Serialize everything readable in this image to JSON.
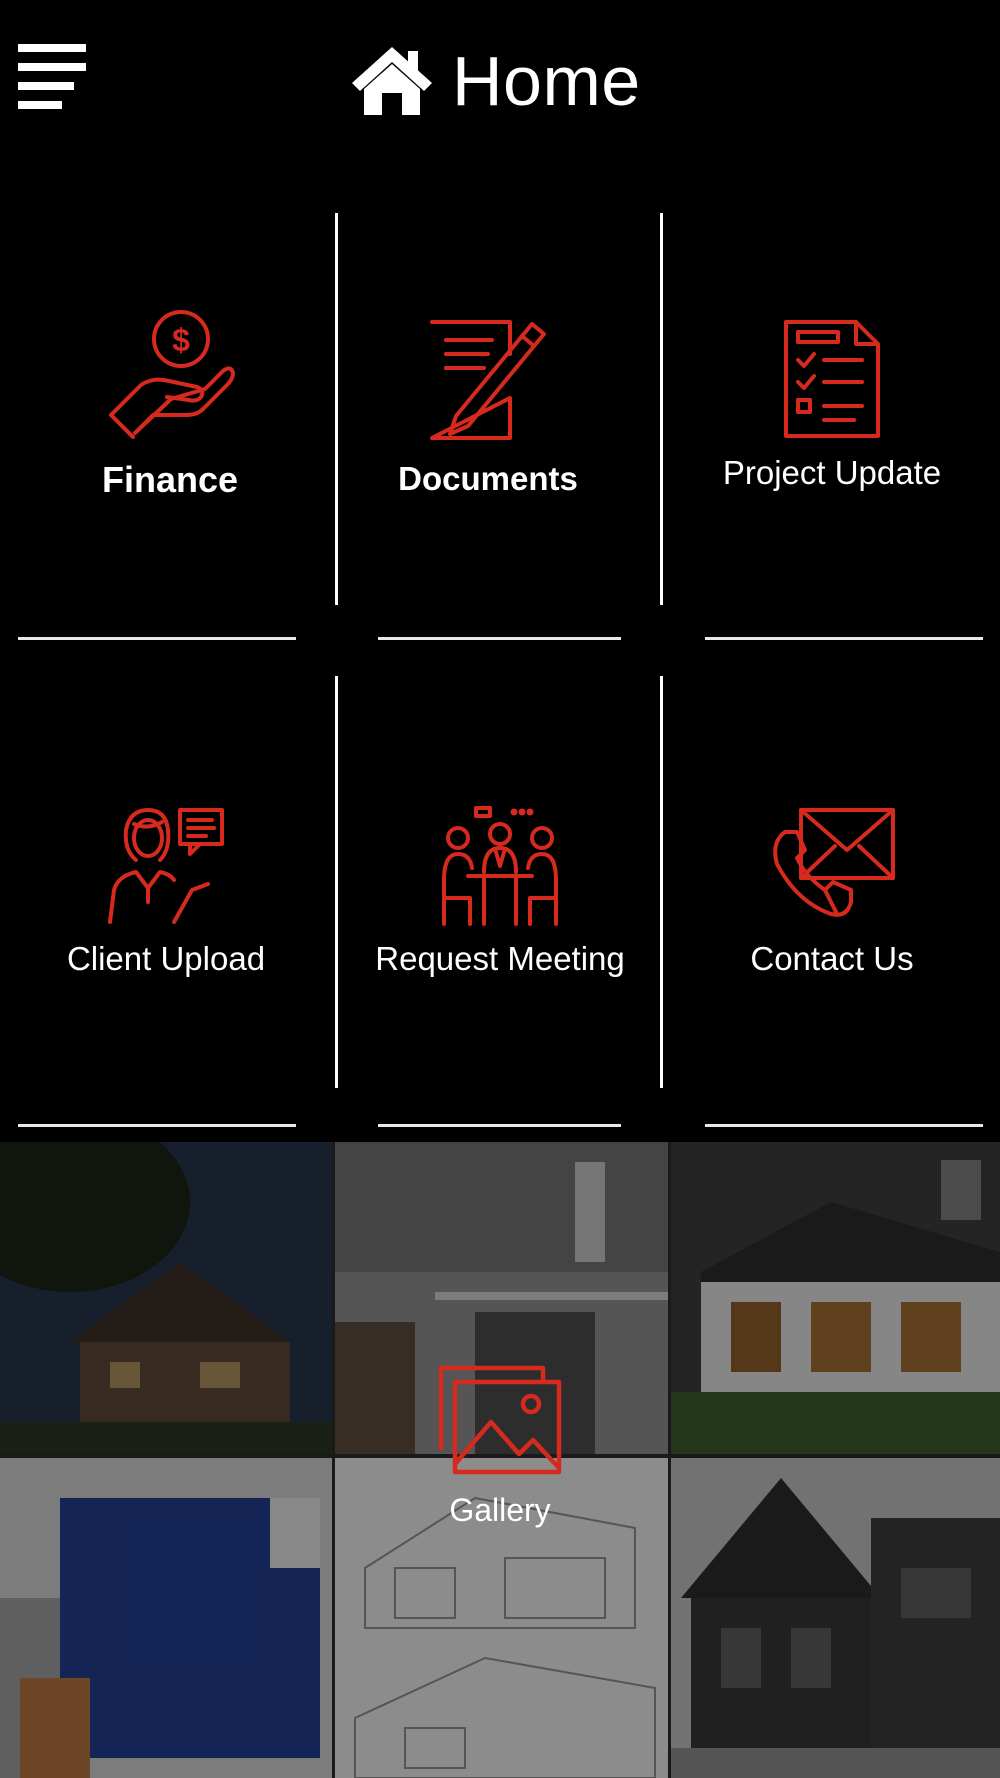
{
  "header": {
    "title": "Home",
    "menu_icon": "hamburger-menu-icon",
    "home_icon": "home-icon"
  },
  "tiles": [
    {
      "label": "Finance",
      "icon": "hand-coin-icon"
    },
    {
      "label": "Documents",
      "icon": "document-pencil-icon"
    },
    {
      "label": "Project Update",
      "icon": "checklist-icon"
    },
    {
      "label": "Client Upload",
      "icon": "woman-chat-icon"
    },
    {
      "label": "Request Meeting",
      "icon": "meeting-icon"
    },
    {
      "label": "Contact Us",
      "icon": "phone-envelope-icon"
    }
  ],
  "gallery": {
    "label": "Gallery",
    "icon": "gallery-icon"
  },
  "colors": {
    "background": "#000000",
    "accent": "#d62a1e",
    "text": "#ffffff"
  }
}
